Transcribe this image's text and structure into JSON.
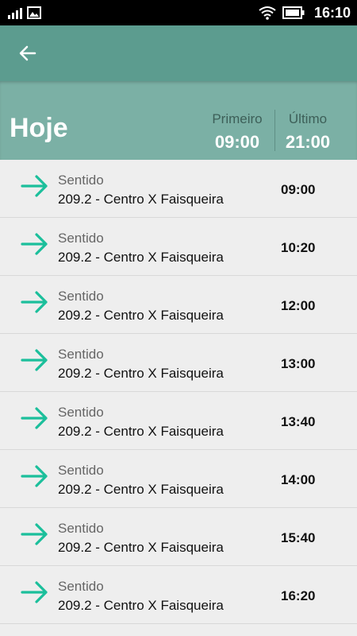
{
  "status_bar": {
    "time": "16:10",
    "icons": [
      "signal-icon",
      "image-icon",
      "wifi-icon",
      "battery-icon"
    ]
  },
  "toolbar": {
    "back_icon": "arrow-left-icon"
  },
  "summary": {
    "day_label": "Hoje",
    "first_label": "Primeiro",
    "first_time": "09:00",
    "last_label": "Último",
    "last_time": "21:00"
  },
  "colors": {
    "toolbar": "#5c9c8f",
    "summary": "#7bb0a5",
    "accent_arrow": "#1bbf9b",
    "list_bg": "#eeeeee"
  },
  "departures": [
    {
      "caption": "Sentido",
      "route": "209.2 - Centro X Faisqueira",
      "time": "09:00",
      "icon": "arrow-right-icon"
    },
    {
      "caption": "Sentido",
      "route": "209.2 - Centro X Faisqueira",
      "time": "10:20",
      "icon": "arrow-right-icon"
    },
    {
      "caption": "Sentido",
      "route": "209.2 - Centro X Faisqueira",
      "time": "12:00",
      "icon": "arrow-right-icon"
    },
    {
      "caption": "Sentido",
      "route": "209.2 - Centro X Faisqueira",
      "time": "13:00",
      "icon": "arrow-right-icon"
    },
    {
      "caption": "Sentido",
      "route": "209.2 - Centro X Faisqueira",
      "time": "13:40",
      "icon": "arrow-right-icon"
    },
    {
      "caption": "Sentido",
      "route": "209.2 - Centro X Faisqueira",
      "time": "14:00",
      "icon": "arrow-right-icon"
    },
    {
      "caption": "Sentido",
      "route": "209.2 - Centro X Faisqueira",
      "time": "15:40",
      "icon": "arrow-right-icon"
    },
    {
      "caption": "Sentido",
      "route": "209.2 - Centro X Faisqueira",
      "time": "16:20",
      "icon": "arrow-right-icon"
    }
  ]
}
